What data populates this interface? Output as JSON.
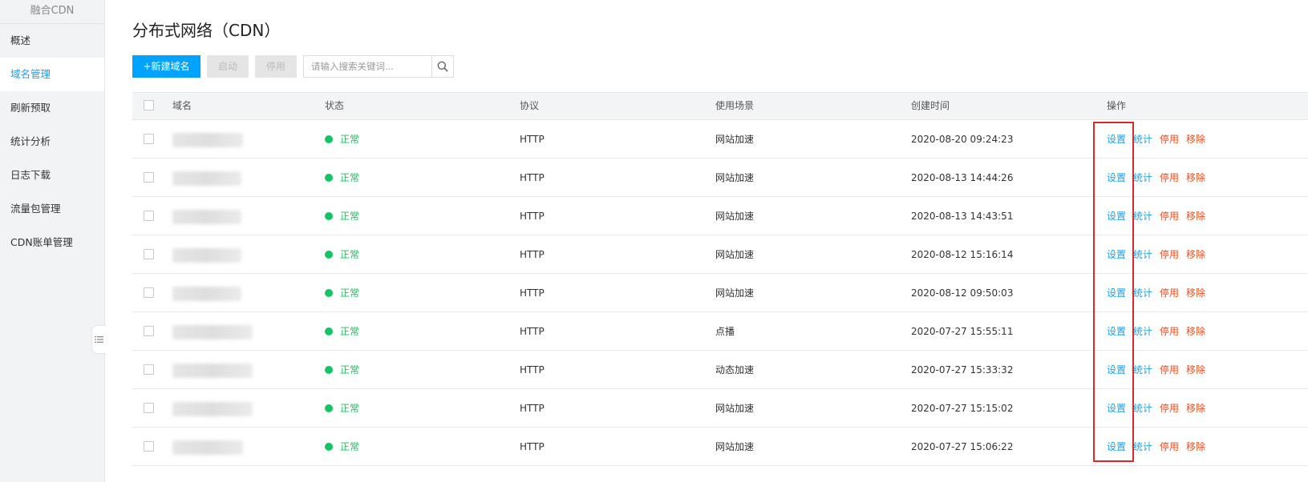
{
  "sidebar": {
    "title": "融合CDN",
    "items": [
      {
        "label": "概述",
        "active": false
      },
      {
        "label": "域名管理",
        "active": true
      },
      {
        "label": "刷新预取",
        "active": false
      },
      {
        "label": "统计分析",
        "active": false
      },
      {
        "label": "日志下载",
        "active": false
      },
      {
        "label": "流量包管理",
        "active": false
      },
      {
        "label": "CDN账单管理",
        "active": false
      }
    ]
  },
  "page": {
    "title": "分布式网络（CDN）"
  },
  "toolbar": {
    "add_label": "+新建域名",
    "start_label": "启动",
    "stop_label": "停用",
    "search_placeholder": "请输入搜索关键词..."
  },
  "table": {
    "headers": {
      "domain": "域名",
      "status": "状态",
      "protocol": "协议",
      "scene": "使用场景",
      "created": "创建时间",
      "actions": "操作"
    },
    "actions": {
      "settings": "设置",
      "stats": "统计",
      "stop": "停用",
      "remove": "移除"
    },
    "rows": [
      {
        "status": "正常",
        "protocol": "HTTP",
        "scene": "网站加速",
        "created": "2020-08-20 09:24:23"
      },
      {
        "status": "正常",
        "protocol": "HTTP",
        "scene": "网站加速",
        "created": "2020-08-13 14:44:26"
      },
      {
        "status": "正常",
        "protocol": "HTTP",
        "scene": "网站加速",
        "created": "2020-08-13 14:43:51"
      },
      {
        "status": "正常",
        "protocol": "HTTP",
        "scene": "网站加速",
        "created": "2020-08-12 15:16:14"
      },
      {
        "status": "正常",
        "protocol": "HTTP",
        "scene": "网站加速",
        "created": "2020-08-12 09:50:03"
      },
      {
        "status": "正常",
        "protocol": "HTTP",
        "scene": "点播",
        "created": "2020-07-27 15:55:11"
      },
      {
        "status": "正常",
        "protocol": "HTTP",
        "scene": "动态加速",
        "created": "2020-07-27 15:33:32"
      },
      {
        "status": "正常",
        "protocol": "HTTP",
        "scene": "网站加速",
        "created": "2020-07-27 15:15:02"
      },
      {
        "status": "正常",
        "protocol": "HTTP",
        "scene": "网站加速",
        "created": "2020-07-27 15:06:22"
      }
    ]
  },
  "colors": {
    "accent": "#00a4ff",
    "link_blue": "#1a9ee8",
    "link_red": "#ea4c1d",
    "status_green": "#12c462",
    "highlight": "#e0262b"
  },
  "icons": {
    "search": "search-icon",
    "collapse": "collapse-sidebar-icon"
  }
}
